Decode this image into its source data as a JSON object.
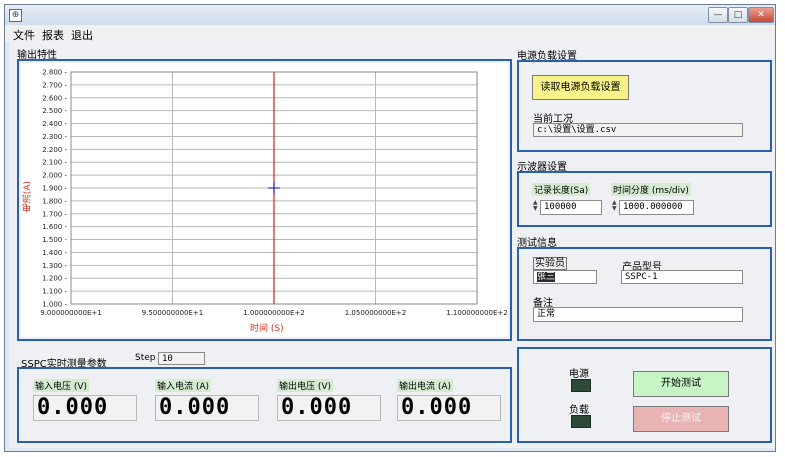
{
  "menu": {
    "file": "文件",
    "report": "报表",
    "exit": "退出"
  },
  "plot": {
    "section_title": "输出特性",
    "y_ticks": [
      "2.800",
      "2.700",
      "2.600",
      "2.500",
      "2.400",
      "2.300",
      "2.200",
      "2.100",
      "2.000",
      "1.900",
      "1.800",
      "1.700",
      "1.600",
      "1.500",
      "1.400",
      "1.300",
      "1.200",
      "1.100",
      "1.000"
    ],
    "x_ticks": [
      "9.000000000E+1",
      "9.500000000E+1",
      "1.000000000E+2",
      "1.050000000E+2",
      "1.100000000E+2"
    ],
    "y_label": "电流(A)",
    "x_label": "时间 (S)",
    "cursor_x": 100,
    "cursor_y": 1.9,
    "xlim": [
      90,
      110
    ],
    "ylim": [
      1.0,
      2.8
    ],
    "cursor_color": "#d02020",
    "crosshair_color": "#3030c0"
  },
  "load": {
    "section_title": "电源负载设置",
    "read_button": "读取电源负载设置",
    "current_label": "当前工况",
    "current_value": "c:\\设置\\设置.csv",
    "button_color": "#f7f38a"
  },
  "scope": {
    "section_title": "示波器设置",
    "record_label": "记录长度(Sa)",
    "record_value": "100000",
    "timediv_label": "时间分度 (ms/div)",
    "timediv_value": "1000.000000"
  },
  "test_info": {
    "section_title": "测试信息",
    "tester_label": "实验员",
    "tester_value": "张三",
    "model_label": "产品型号",
    "model_value": "SSPC-1",
    "note_label": "备注",
    "note_value": "正常"
  },
  "measure": {
    "section_title": "SSPC实时测量参数",
    "step_label": "Step",
    "step_value": "10",
    "vin_label": "输入电压 (V)",
    "vin_value": "0.000",
    "iin_label": "输入电流 (A)",
    "iin_value": "0.000",
    "vout_label": "输出电压 (V)",
    "vout_value": "0.000",
    "iout_label": "输出电流 (A)",
    "iout_value": "0.000"
  },
  "control": {
    "power_label": "电源",
    "load_label": "负载",
    "start_button": "开始测试",
    "stop_button": "停止测试",
    "start_color": "#c8f5c6",
    "stop_color": "#eab3b3"
  }
}
